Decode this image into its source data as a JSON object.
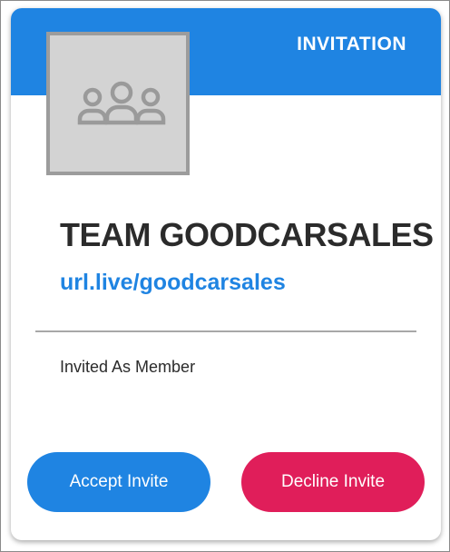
{
  "header": {
    "label": "INVITATION",
    "band_color": "#1f84e2"
  },
  "team": {
    "avatar_icon": "people-group-icon",
    "name": "TEAM GOODCARSALES",
    "url": "url.live/goodcarsales"
  },
  "invite": {
    "role_text": "Invited As Member"
  },
  "actions": {
    "accept_label": "Accept Invite",
    "accept_color": "#1f84e2",
    "decline_label": "Decline Invite",
    "decline_color": "#e01e5a"
  }
}
